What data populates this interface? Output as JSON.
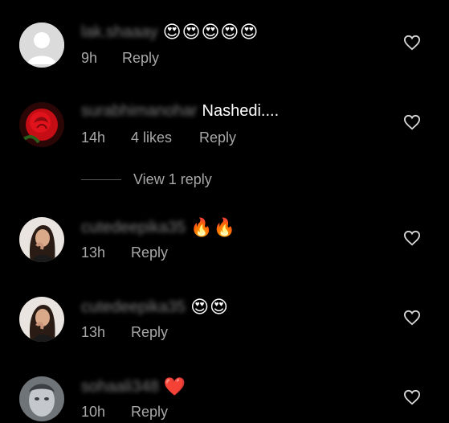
{
  "comments": [
    {
      "username": "lak.shaaay",
      "text": "",
      "emoji": "😍😍😍😍😍",
      "time": "9h",
      "likes": "",
      "reply_label": "Reply",
      "avatar": "default-avatar"
    },
    {
      "username": "surabhimanohar",
      "text": "Nashedi....",
      "emoji": "",
      "time": "14h",
      "likes": "4 likes",
      "reply_label": "Reply",
      "avatar": "rose-avatar"
    },
    {
      "username": "cutedeepika35",
      "text": "",
      "emoji": "🔥🔥",
      "time": "13h",
      "likes": "",
      "reply_label": "Reply",
      "avatar": "woman-avatar"
    },
    {
      "username": "cutedeepika35",
      "text": "",
      "emoji": "😍😍",
      "time": "13h",
      "likes": "",
      "reply_label": "Reply",
      "avatar": "woman-avatar"
    },
    {
      "username": "sohaali348",
      "text": "",
      "emoji": "❤️",
      "time": "10h",
      "likes": "",
      "reply_label": "Reply",
      "avatar": "portrait-avatar"
    }
  ],
  "view_replies": "View 1 reply",
  "colors": {
    "background": "#000000",
    "text": "#ffffff",
    "muted": "#a8a8a8"
  }
}
